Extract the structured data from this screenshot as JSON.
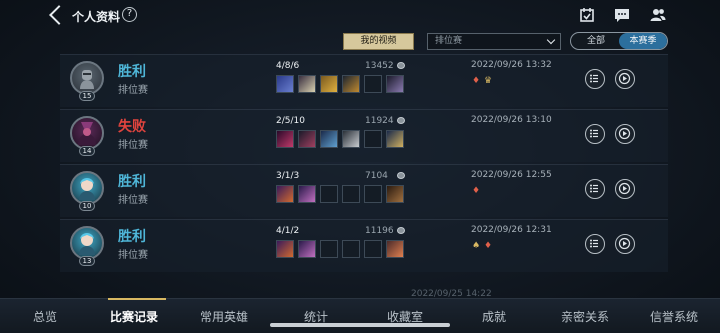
{
  "header": {
    "title": "个人资料",
    "help_glyph": "?",
    "icons": [
      "back-icon",
      "help-icon",
      "calendar-check-icon",
      "chat-icon",
      "friends-icon"
    ]
  },
  "filters": {
    "my_videos_label": "我的视频",
    "mode_select_value": "排位赛",
    "season_toggle": {
      "all_label": "全部",
      "current_label": "本赛季",
      "selected": "本赛季"
    }
  },
  "colors": {
    "win": "#4fb6d8",
    "loss": "#e0443e",
    "accent_gold": "#d8b862",
    "toggle_active": "#2c6f9d"
  },
  "matches": [
    {
      "result": "胜利",
      "mode": "排位赛",
      "level": "15",
      "kda": "4/8/6",
      "gold": "13452",
      "time": "2022/09/26 13:32",
      "badge_icons": [
        "mvp-shield-icon",
        "trophy-icon"
      ],
      "avatar_colors": [
        "#5a6670",
        "#2a3038"
      ]
    },
    {
      "result": "失败",
      "mode": "排位赛",
      "level": "14",
      "kda": "2/5/10",
      "gold": "11924",
      "time": "2022/09/26 13:10",
      "badge_icons": [],
      "avatar_colors": [
        "#5b2a58",
        "#1c0f1f"
      ]
    },
    {
      "result": "胜利",
      "mode": "排位赛",
      "level": "10",
      "kda": "3/1/3",
      "gold": "7104",
      "time": "2022/09/26 12:55",
      "badge_icons": [
        "mvp-shield-icon"
      ],
      "avatar_colors": [
        "#3fa8c6",
        "#16313d"
      ]
    },
    {
      "result": "胜利",
      "mode": "排位赛",
      "level": "13",
      "kda": "4/1/2",
      "gold": "11196",
      "time": "2022/09/26 12:31",
      "badge_icons": [
        "wings-icon",
        "mvp-shield-icon"
      ],
      "avatar_colors": [
        "#3fa8c6",
        "#16313d"
      ]
    }
  ],
  "partial_next_time": "2022/09/25 14:22",
  "nav_tabs": [
    {
      "label": "总览"
    },
    {
      "label": "比赛记录",
      "active": true
    },
    {
      "label": "常用英雄"
    },
    {
      "label": "统计"
    },
    {
      "label": "收藏室"
    },
    {
      "label": "成就"
    },
    {
      "label": "亲密关系"
    },
    {
      "label": "信誉系统"
    }
  ]
}
